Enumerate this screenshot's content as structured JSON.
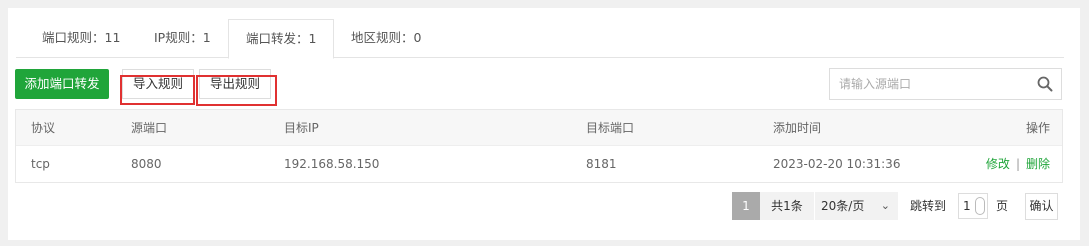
{
  "tabs": [
    {
      "label": "端口规则：11"
    },
    {
      "label": "IP规则：1"
    },
    {
      "label": "端口转发：1"
    },
    {
      "label": "地区规则：0"
    }
  ],
  "toolbar": {
    "add_label": "添加端口转发",
    "import_label": "导入规则",
    "export_label": "导出规则"
  },
  "search": {
    "placeholder": "请输入源端口"
  },
  "table": {
    "headers": [
      "协议",
      "源端口",
      "目标IP",
      "目标端口",
      "添加时间",
      "操作"
    ],
    "rows": [
      {
        "protocol": "tcp",
        "source_port": "8080",
        "target_ip": "192.168.58.150",
        "target_port": "8181",
        "added_time": "2023-02-20 10:31:36",
        "edit_label": "修改",
        "separator": "|",
        "delete_label": "删除"
      }
    ]
  },
  "pagination": {
    "current_page": "1",
    "total": "共1条",
    "page_size": "20条/页",
    "jump_label": "跳转到",
    "jump_value": "1",
    "page_unit": "页",
    "confirm_label": "确认"
  },
  "colors": {
    "accent": "#20a53a",
    "highlight": "#e03131"
  }
}
